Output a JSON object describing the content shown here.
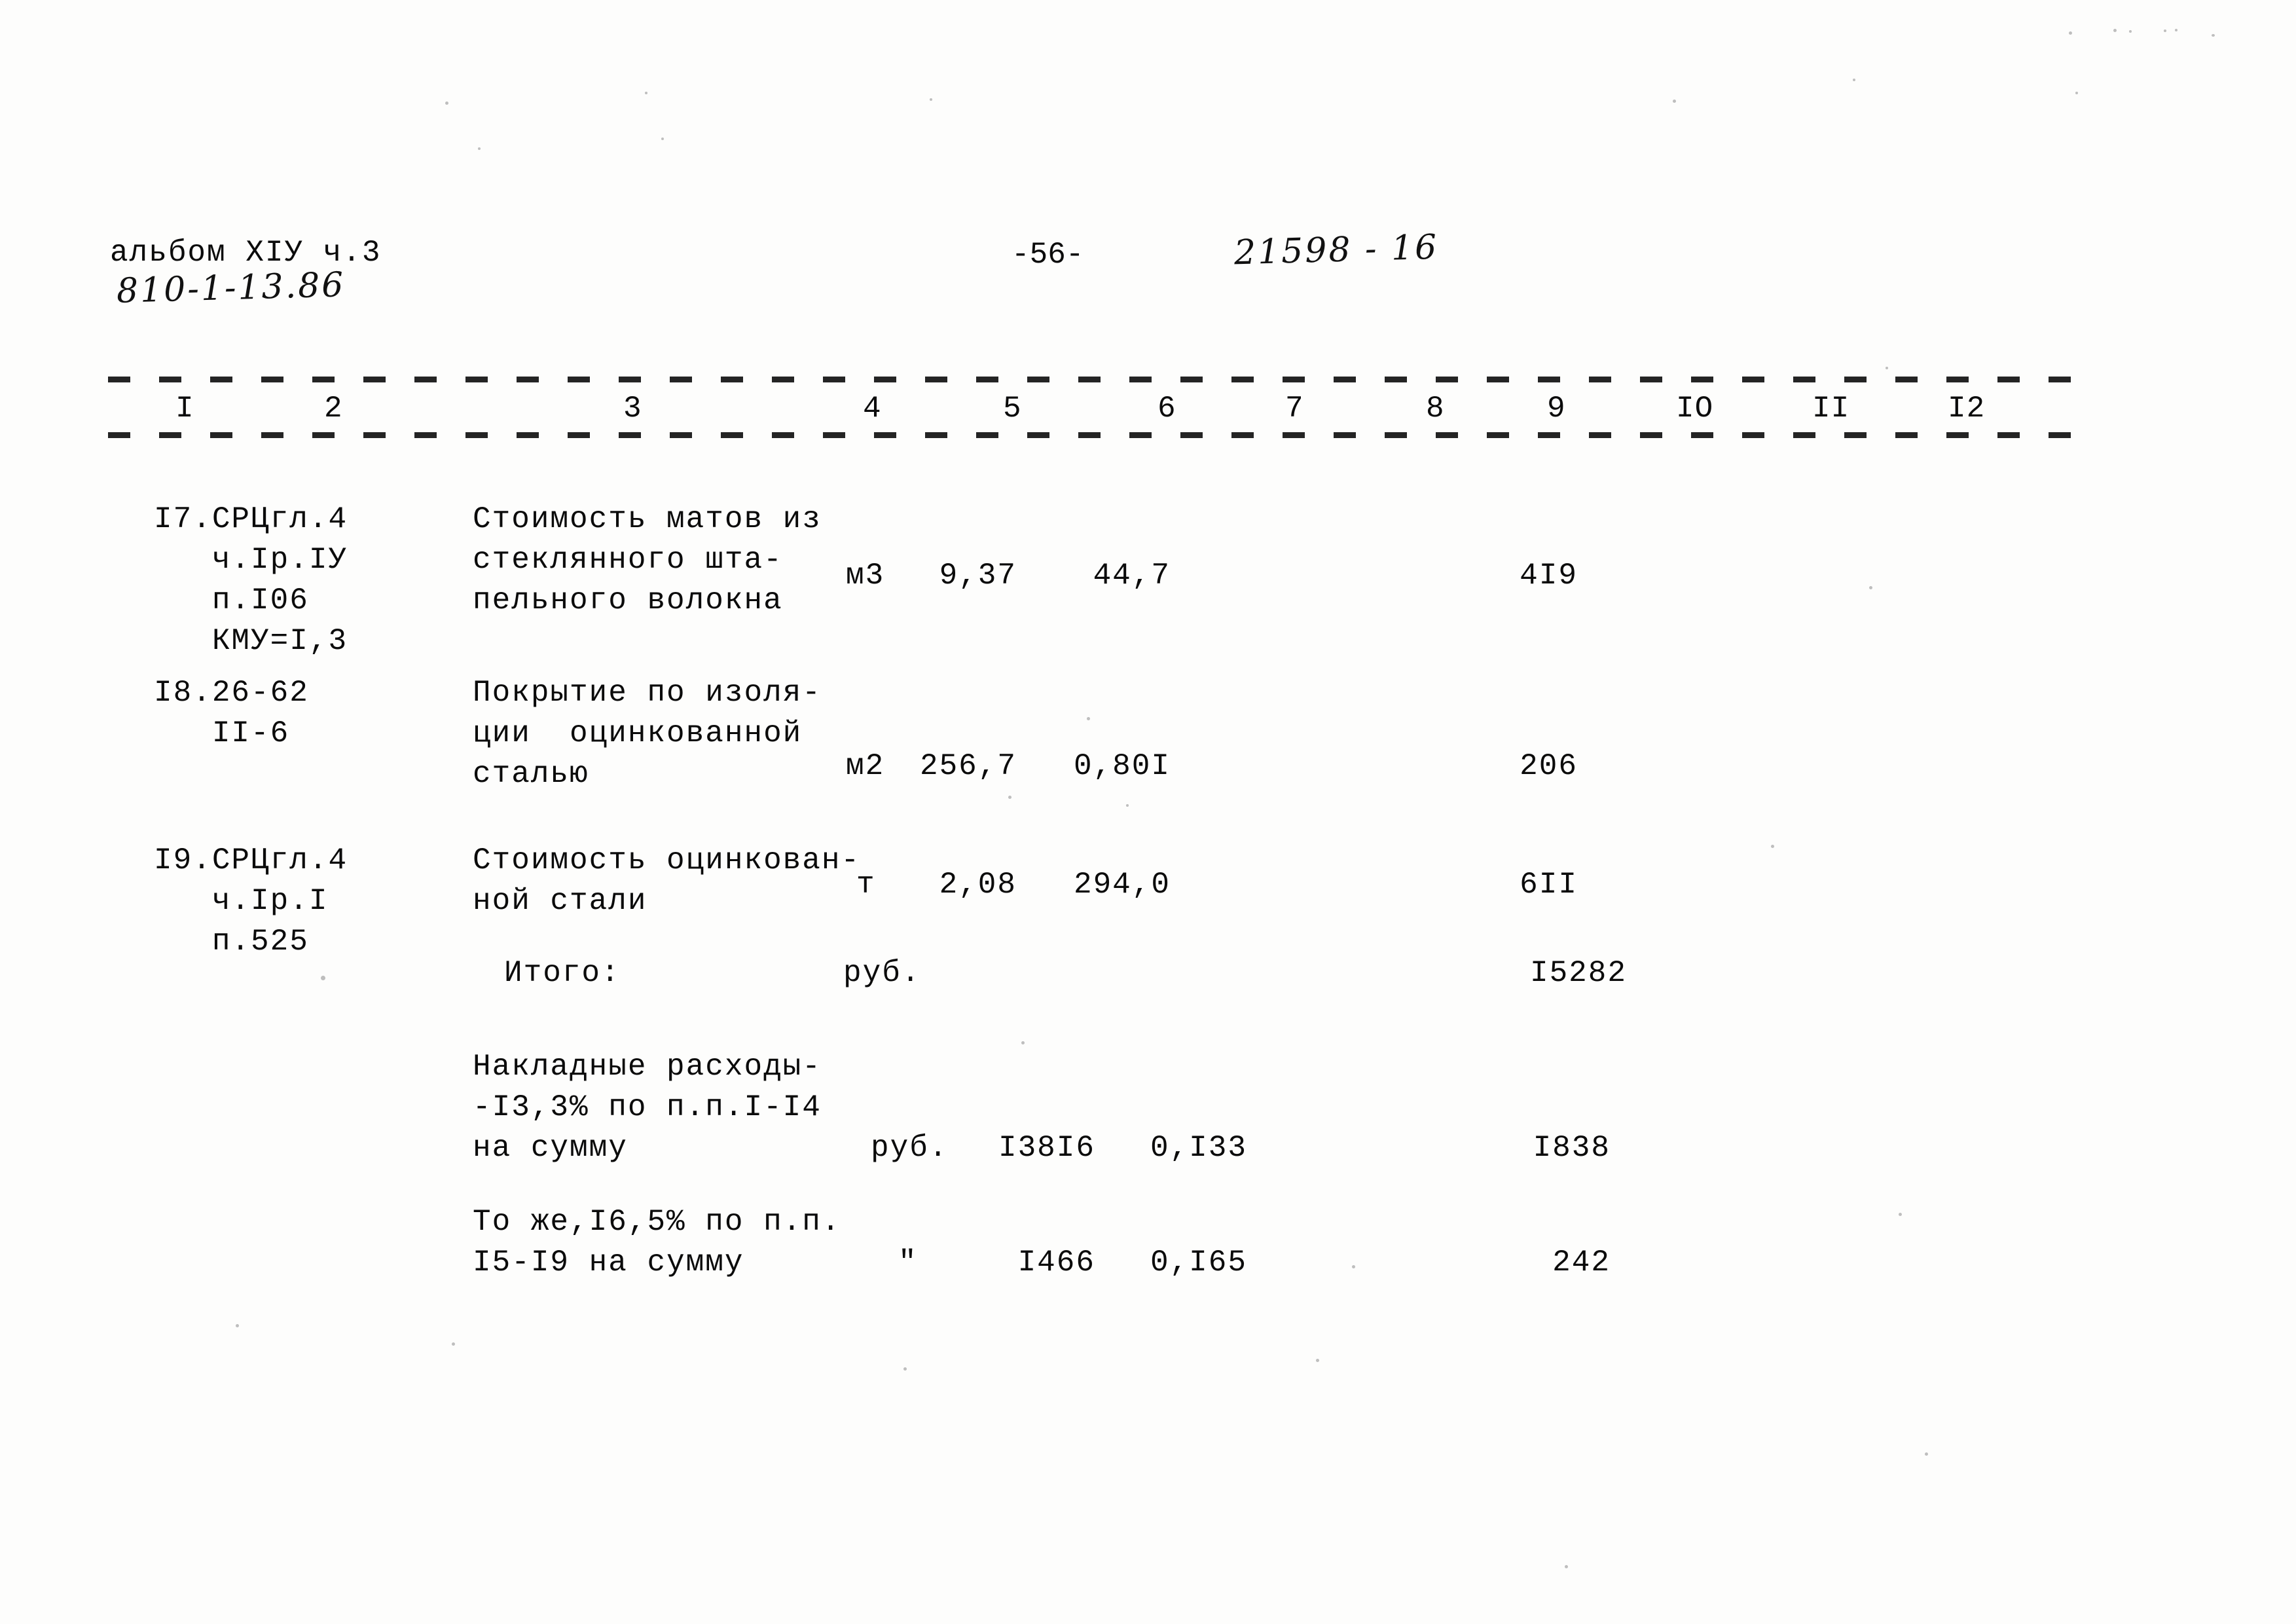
{
  "header": {
    "album_label": "альбом XIУ ч.3",
    "album_handwritten": "810-1-13.86",
    "page_number": "-56-",
    "doc_number": "21598 - 16"
  },
  "table": {
    "column_headers": [
      "I",
      "2",
      "3",
      "4",
      "5",
      "6",
      "7",
      "8",
      "9",
      "IO",
      "II",
      "I2"
    ],
    "rows": [
      {
        "code": "I7.СРЦгл.4\n   ч.Iр.IУ\n   п.I06\n   КМУ=I,3",
        "description": "Стоимость матов из\nстеклянного шта-\nпельного волокна",
        "unit": "м3",
        "qty": "9,37",
        "price": "44,7",
        "col7": "",
        "col8": "",
        "total": "4I9",
        "col10": "",
        "col11": "",
        "col12": ""
      },
      {
        "code": "I8.26-62\n   II-6",
        "description": "Покрытие по изоля-\nции  оцинкованной\nсталью",
        "unit": "м2",
        "qty": "256,7",
        "price": "0,80I",
        "col7": "",
        "col8": "",
        "total": "206",
        "col10": "",
        "col11": "",
        "col12": ""
      },
      {
        "code": "I9.СРЦгл.4\n   ч.Iр.I\n   п.525",
        "description": "Стоимость оцинкован-\nной стали",
        "unit": "т",
        "qty": "2,08",
        "price": "294,0",
        "col7": "",
        "col8": "",
        "total": "6II",
        "col10": "",
        "col11": "",
        "col12": ""
      }
    ],
    "summary_rows": [
      {
        "code": "",
        "description": "Итого:",
        "unit": "руб.",
        "qty": "",
        "price": "",
        "total": "I5282"
      },
      {
        "code": "",
        "description": "Накладные расходы-\n-I3,3% по п.п.I-I4\nна сумму",
        "unit": "руб.",
        "qty": "I38I6",
        "price": "0,I33",
        "total": "I838"
      },
      {
        "code": "",
        "description": "То же,I6,5% по п.п.\nI5-I9 на сумму",
        "unit": "\"",
        "qty": "I466",
        "price": "0,I65",
        "total": "242"
      }
    ]
  }
}
